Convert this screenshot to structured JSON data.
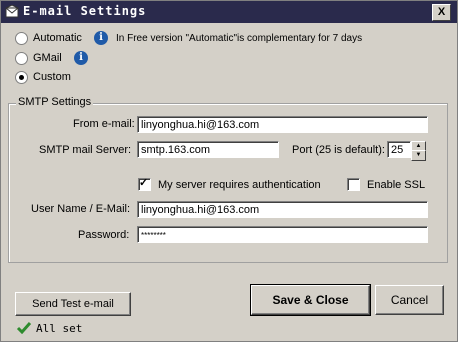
{
  "window": {
    "title": "E-mail Settings",
    "close_label": "X"
  },
  "mode": {
    "options": [
      {
        "label": "Automatic",
        "checked": false
      },
      {
        "label": "GMail",
        "checked": false
      },
      {
        "label": "Custom",
        "checked": true
      }
    ],
    "automatic_note": "In Free version \"Automatic\"is complementary for 7 days",
    "info_glyph": "i"
  },
  "smtp": {
    "group_title": "SMTP Settings",
    "from_label": "From e-mail:",
    "from_value": "linyonghua.hi@163.com",
    "server_label": "SMTP mail Server:",
    "server_value": "smtp.163.com",
    "port_label": "Port (25 is default):",
    "port_value": "25",
    "auth_label": "My server requires authentication",
    "auth_checked": true,
    "ssl_label": "Enable SSL",
    "ssl_checked": false,
    "user_label": "User Name / E-Mail:",
    "user_value": "linyonghua.hi@163.com",
    "password_label": "Password:",
    "password_value": "********"
  },
  "buttons": {
    "test_label": "Send Test e-mail",
    "save_label": "Save & Close",
    "cancel_label": "Cancel"
  },
  "status": {
    "text": "All set",
    "icon": "checkmark-icon",
    "icon_color": "#2e8b2e"
  },
  "colors": {
    "titlebar": "#2a2a4c",
    "info": "#1f5aa8",
    "dialog": "#d4d0c8"
  }
}
